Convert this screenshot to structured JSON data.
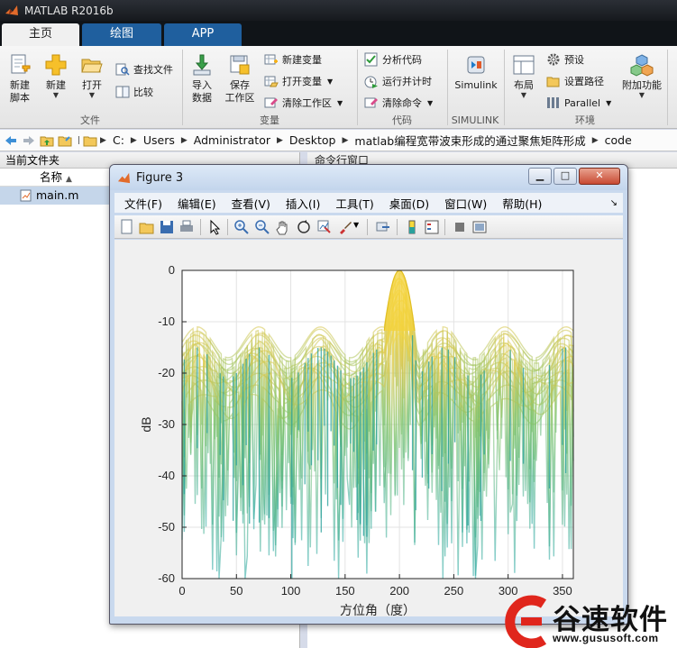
{
  "app": {
    "title": "MATLAB R2016b"
  },
  "tabs": [
    "主页",
    "绘图",
    "APP"
  ],
  "ribbon": {
    "file": {
      "new_script": [
        "新建",
        "脚本"
      ],
      "new": "新建",
      "open": "打开",
      "find_files": "查找文件",
      "compare": "比较",
      "group": "文件"
    },
    "variable": {
      "import": [
        "导入",
        "数据"
      ],
      "save_workspace": [
        "保存",
        "工作区"
      ],
      "new_variable": "新建变量",
      "open_variable": "打开变量",
      "clear_workspace": "清除工作区",
      "group": "变量"
    },
    "code": {
      "analyze": "分析代码",
      "run_and_time": "运行并计时",
      "clear_commands": "清除命令",
      "group": "代码"
    },
    "simulink": {
      "label": "Simulink",
      "group": "SIMULINK"
    },
    "environment": {
      "layout": "布局",
      "preferences": "预设",
      "set_path": "设置路径",
      "parallel": "Parallel",
      "addons": "附加功能",
      "group": "环境"
    }
  },
  "address": {
    "crumbs": [
      "C:",
      "Users",
      "Administrator",
      "Desktop",
      "matlab编程宽带波束形成的通过聚焦矩阵形成",
      "code"
    ]
  },
  "left_panel": {
    "title": "当前文件夹",
    "column_name": "名称",
    "files": [
      "main.m"
    ]
  },
  "command_window": {
    "title": "命令行窗口"
  },
  "figure": {
    "title": "Figure 3",
    "menus": [
      "文件(F)",
      "编辑(E)",
      "查看(V)",
      "插入(I)",
      "工具(T)",
      "桌面(D)",
      "窗口(W)",
      "帮助(H)"
    ],
    "window_buttons": [
      "minimize",
      "maximize",
      "close"
    ]
  },
  "chart_data": {
    "type": "surface",
    "title": "",
    "xlabel": "方位角（度）",
    "ylabel": "dB",
    "xlim": [
      0,
      360
    ],
    "ylim": [
      -60,
      0
    ],
    "xticks": [
      0,
      50,
      100,
      150,
      200,
      250,
      300,
      350
    ],
    "yticks": [
      0,
      -10,
      -20,
      -30,
      -40,
      -50,
      -60
    ],
    "grid": true,
    "colormap": "parula (teal to yellow)",
    "main_lobe": {
      "azimuth_deg": 200,
      "peak_db": 0
    },
    "sidelobe_level_db": -12,
    "nulls": [
      {
        "azimuth_deg": 100,
        "min_db": -60
      },
      {
        "azimuth_deg": 330,
        "min_db": -60
      }
    ]
  },
  "watermark": {
    "text": "谷速软件",
    "url": "www.gususoft.com"
  },
  "colors": {
    "title_bar": "#1a1e23",
    "tab_strip": "#101418",
    "tab_inactive": "#1f5f9e",
    "ribbon": "#ececec",
    "figure_frame": "#c9d9ee",
    "surface_low": "#20a39e",
    "surface_high": "#f7d93b",
    "watermark_red": "#e0261c"
  }
}
